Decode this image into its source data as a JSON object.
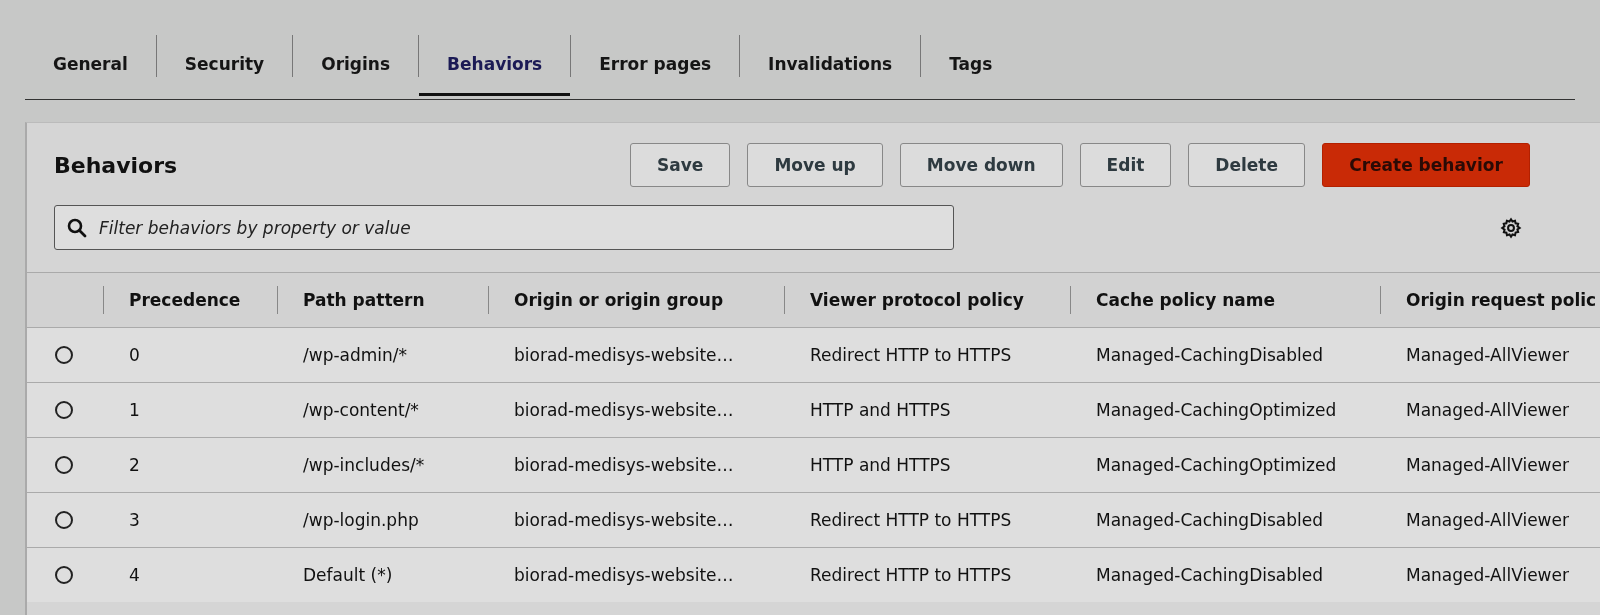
{
  "tabs": [
    {
      "label": "General",
      "selected": false
    },
    {
      "label": "Security",
      "selected": false
    },
    {
      "label": "Origins",
      "selected": false
    },
    {
      "label": "Behaviors",
      "selected": true
    },
    {
      "label": "Error pages",
      "selected": false
    },
    {
      "label": "Invalidations",
      "selected": false
    },
    {
      "label": "Tags",
      "selected": false
    }
  ],
  "panel": {
    "title": "Behaviors",
    "buttons": [
      {
        "label": "Save",
        "kind": "normal"
      },
      {
        "label": "Move up",
        "kind": "normal"
      },
      {
        "label": "Move down",
        "kind": "normal"
      },
      {
        "label": "Edit",
        "kind": "normal"
      },
      {
        "label": "Delete",
        "kind": "normal"
      },
      {
        "label": "Create behavior",
        "kind": "primary"
      }
    ],
    "search": {
      "placeholder": "Filter behaviors by property or value"
    }
  },
  "table": {
    "columns": [
      "Precedence",
      "Path pattern",
      "Origin or origin group",
      "Viewer protocol policy",
      "Cache policy name",
      "Origin request polic"
    ],
    "rows": [
      {
        "selected": false,
        "cells": [
          "0",
          "/wp-admin/*",
          "biorad-medisys-website…",
          "Redirect HTTP to HTTPS",
          "Managed-CachingDisabled",
          "Managed-AllViewer"
        ]
      },
      {
        "selected": false,
        "cells": [
          "1",
          "/wp-content/*",
          "biorad-medisys-website…",
          "HTTP and HTTPS",
          "Managed-CachingOptimized",
          "Managed-AllViewer"
        ]
      },
      {
        "selected": false,
        "cells": [
          "2",
          "/wp-includes/*",
          "biorad-medisys-website…",
          "HTTP and HTTPS",
          "Managed-CachingOptimized",
          "Managed-AllViewer"
        ]
      },
      {
        "selected": false,
        "cells": [
          "3",
          "/wp-login.php",
          "biorad-medisys-website…",
          "Redirect HTTP to HTTPS",
          "Managed-CachingDisabled",
          "Managed-AllViewer"
        ]
      },
      {
        "selected": false,
        "cells": [
          "4",
          "Default (*)",
          "biorad-medisys-website…",
          "Redirect HTTP to HTTPS",
          "Managed-CachingDisabled",
          "Managed-AllViewer"
        ]
      }
    ]
  }
}
